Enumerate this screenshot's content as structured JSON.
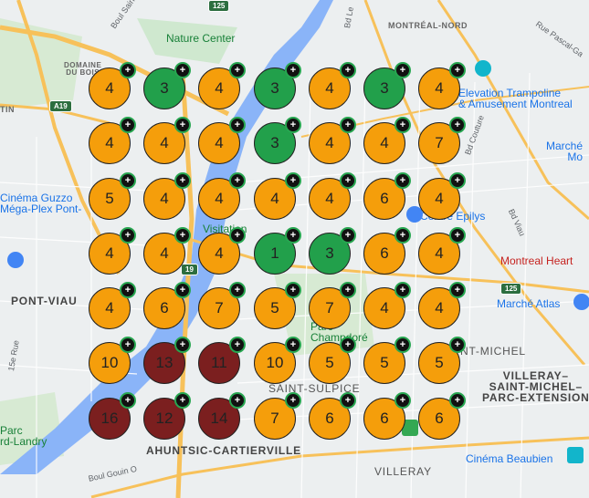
{
  "map": {
    "place_labels": {
      "nature_center": "Nature Center",
      "domaine_du_bois": "DOMAINE\nDU BOIS",
      "montreal_nord": "MONTRÉAL-NORD",
      "elevation_trampoline": "Elevation Trampoline\n& Amusement Montreal",
      "marche": "Marché\nMo",
      "cinema_guzzo": "Cinéma Guzzo\nMéga-Plex Pont-",
      "visitation": "Visitation",
      "epilys": "Centre Epilys",
      "montreal_heart": "Montreal Heart",
      "pont_viau": "PONT-VIAU",
      "marche_atlas": "Marché Atlas",
      "parc_champdore": "Parc\nChampdoré",
      "saint_michel": "NT-MICHEL",
      "villeray_saint_michel": "VILLERAY–\nSAINT-MICHEL–\nPARC-EXTENSION",
      "saint_sulpice": "SAINT-SULPICE",
      "ahuntsic": "AHUNTSIC-CARTIERVILLE",
      "parc_landry": "Parc\nrd-Landry",
      "cinema_beaubien": "Cinéma Beaubien",
      "villeray": "VILLERAY",
      "itin": "TIN"
    },
    "road_labels": {
      "boul_saint_martin": "Boul Saint-Martin E",
      "bd_le": "Bd Le",
      "rue_pascal": "Rue Pascal-Ga",
      "bd_couture": "Bd Couture",
      "rue_15e": "15e Rue",
      "boul_gouin": "Boul Gouin O",
      "bd_viau": "Bd Viau"
    },
    "highway_shields": [
      "125",
      "A19",
      "19",
      "125"
    ],
    "markers": [
      {
        "count": "4",
        "status": "orange"
      },
      {
        "count": "3",
        "status": "green"
      },
      {
        "count": "4",
        "status": "orange"
      },
      {
        "count": "3",
        "status": "green"
      },
      {
        "count": "4",
        "status": "orange"
      },
      {
        "count": "3",
        "status": "green"
      },
      {
        "count": "4",
        "status": "orange"
      },
      {
        "count": "4",
        "status": "orange"
      },
      {
        "count": "4",
        "status": "orange"
      },
      {
        "count": "4",
        "status": "orange"
      },
      {
        "count": "3",
        "status": "green"
      },
      {
        "count": "4",
        "status": "orange"
      },
      {
        "count": "4",
        "status": "orange"
      },
      {
        "count": "7",
        "status": "orange"
      },
      {
        "count": "5",
        "status": "orange"
      },
      {
        "count": "4",
        "status": "orange"
      },
      {
        "count": "4",
        "status": "orange"
      },
      {
        "count": "4",
        "status": "orange"
      },
      {
        "count": "4",
        "status": "orange"
      },
      {
        "count": "6",
        "status": "orange"
      },
      {
        "count": "4",
        "status": "orange"
      },
      {
        "count": "4",
        "status": "orange"
      },
      {
        "count": "4",
        "status": "orange"
      },
      {
        "count": "4",
        "status": "orange"
      },
      {
        "count": "1",
        "status": "green"
      },
      {
        "count": "3",
        "status": "green"
      },
      {
        "count": "6",
        "status": "orange"
      },
      {
        "count": "4",
        "status": "orange"
      },
      {
        "count": "4",
        "status": "orange"
      },
      {
        "count": "6",
        "status": "orange"
      },
      {
        "count": "7",
        "status": "orange"
      },
      {
        "count": "5",
        "status": "orange"
      },
      {
        "count": "7",
        "status": "orange"
      },
      {
        "count": "4",
        "status": "orange"
      },
      {
        "count": "4",
        "status": "orange"
      },
      {
        "count": "10",
        "status": "orange"
      },
      {
        "count": "13",
        "status": "red"
      },
      {
        "count": "11",
        "status": "red"
      },
      {
        "count": "10",
        "status": "orange"
      },
      {
        "count": "5",
        "status": "orange"
      },
      {
        "count": "5",
        "status": "orange"
      },
      {
        "count": "5",
        "status": "orange"
      },
      {
        "count": "16",
        "status": "red"
      },
      {
        "count": "12",
        "status": "red"
      },
      {
        "count": "14",
        "status": "red"
      },
      {
        "count": "7",
        "status": "orange"
      },
      {
        "count": "6",
        "status": "orange"
      },
      {
        "count": "6",
        "status": "orange"
      },
      {
        "count": "6",
        "status": "orange"
      }
    ],
    "marker_plus_symbol": "+",
    "colors": {
      "orange": "#f59e0b",
      "green": "#22a04b",
      "red": "#7b1f1f",
      "water": "#7fb3f0",
      "highway": "#f5b73b",
      "park": "#c8e6c9"
    }
  }
}
